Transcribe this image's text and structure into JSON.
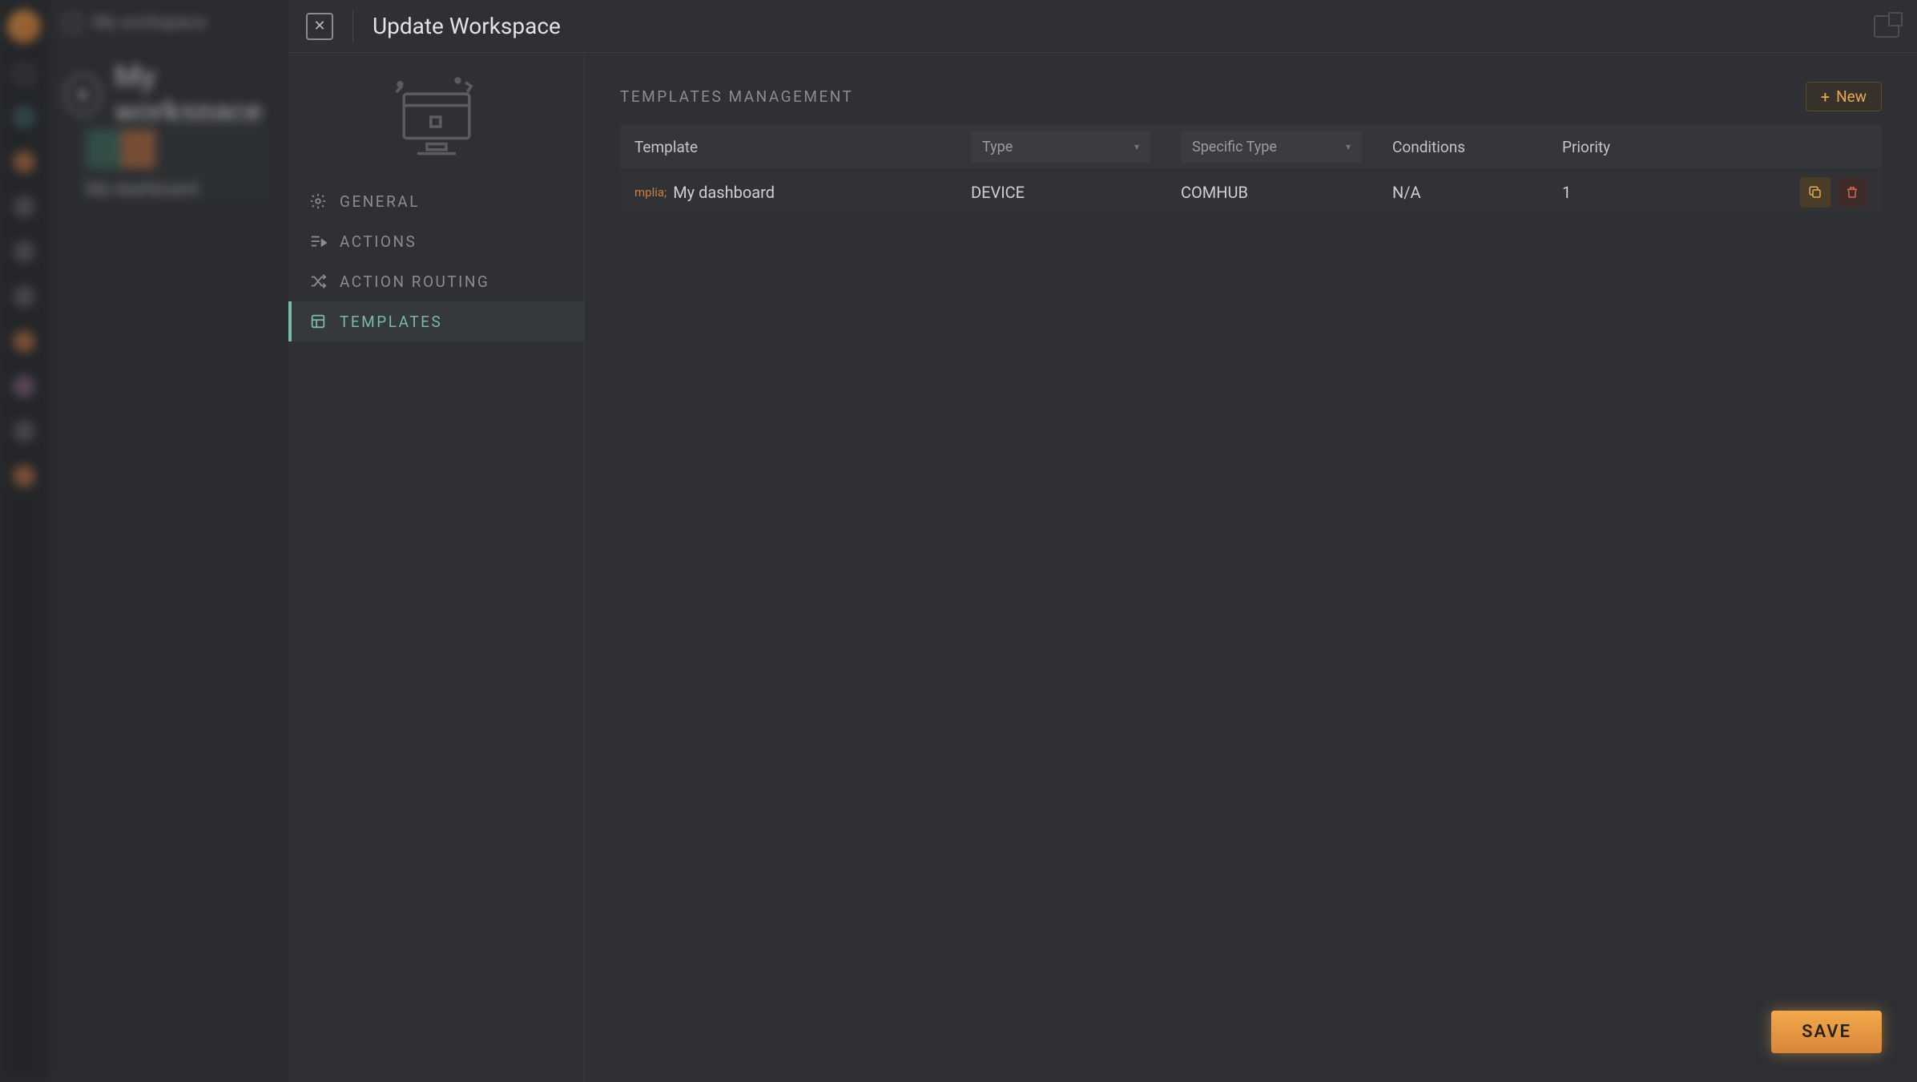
{
  "background": {
    "breadcrumb": "My workspace",
    "title": "My workspace",
    "card_label": "My dashboard"
  },
  "modal": {
    "title": "Update Workspace",
    "save_label": "SAVE"
  },
  "sidebar": {
    "items": [
      {
        "label": "GENERAL"
      },
      {
        "label": "ACTIONS"
      },
      {
        "label": "ACTION ROUTING"
      },
      {
        "label": "TEMPLATES"
      }
    ]
  },
  "section": {
    "title": "TEMPLATES MANAGEMENT",
    "new_label": "New"
  },
  "table": {
    "headers": {
      "template": "Template",
      "type": "Type",
      "specific_type": "Specific Type",
      "conditions": "Conditions",
      "priority": "Priority"
    },
    "rows": [
      {
        "badge": "mplia;",
        "name": "My dashboard",
        "type": "DEVICE",
        "specific_type": "COMHUB",
        "conditions": "N/A",
        "priority": "1"
      }
    ]
  }
}
